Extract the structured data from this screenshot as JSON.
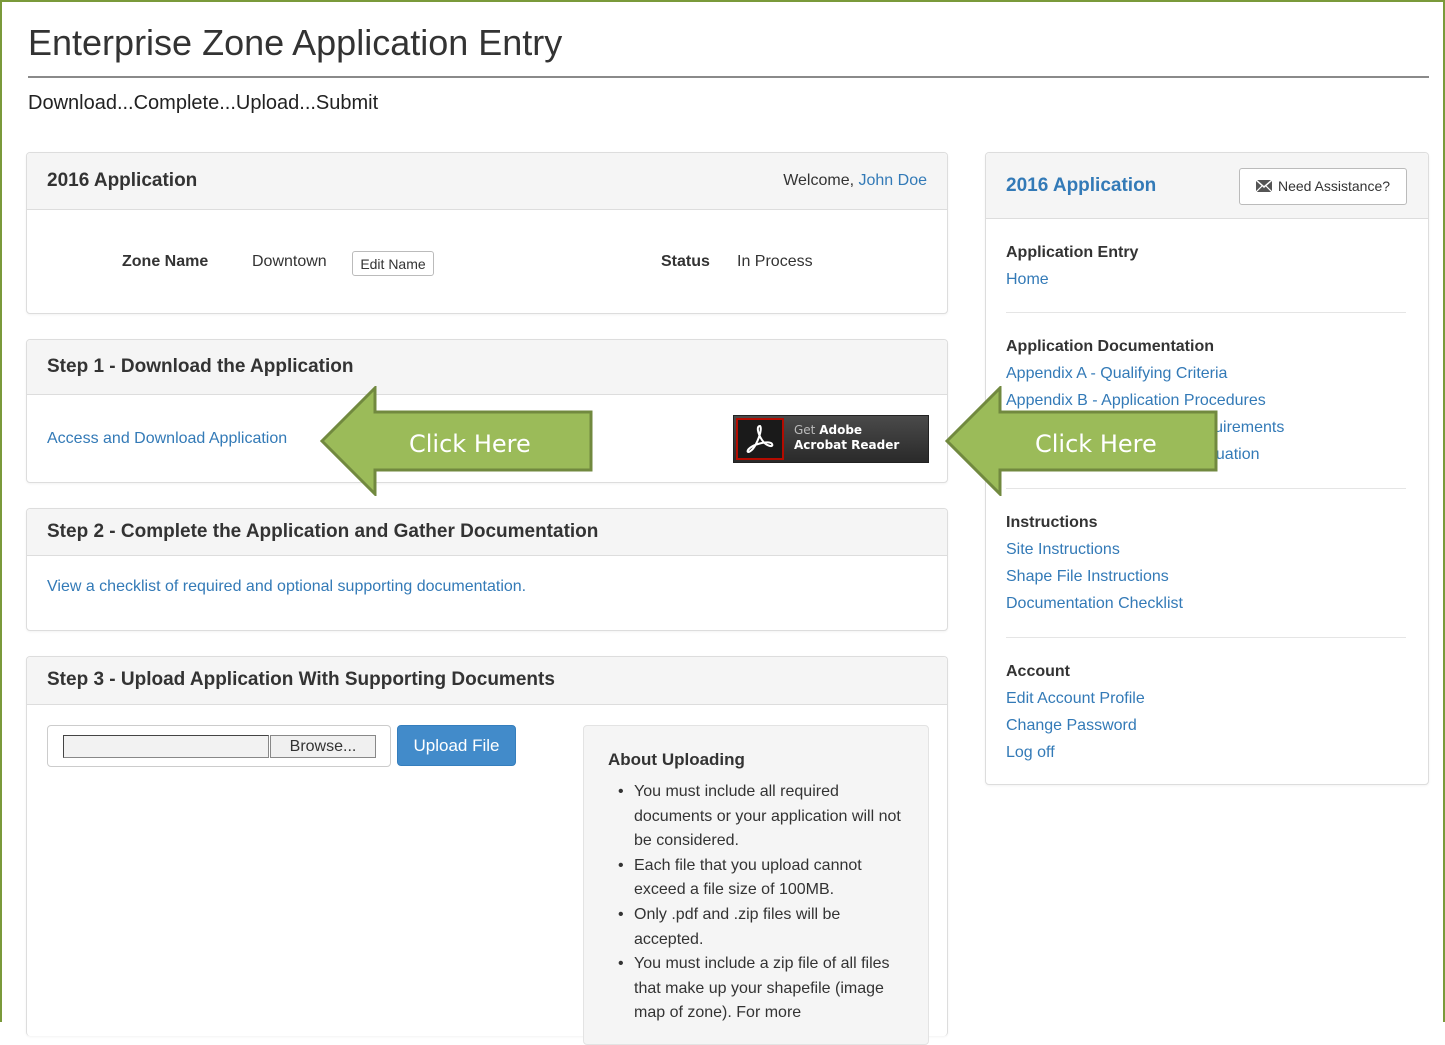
{
  "page": {
    "title": "Enterprise Zone Application Entry",
    "tagline": "Download...Complete...Upload...Submit"
  },
  "app_panel": {
    "heading": "2016 Application",
    "welcome_prefix": "Welcome,",
    "user_name": "John Doe",
    "zone_label": "Zone Name",
    "zone_value": "Downtown",
    "edit_name_button": "Edit Name",
    "status_label": "Status",
    "status_value": "In Process"
  },
  "step1": {
    "heading": "Step 1 - Download the Application",
    "link": "Access and Download Application",
    "adobe_get": "Get",
    "adobe_brand": "Adobe",
    "adobe_product": "Acrobat Reader"
  },
  "step2": {
    "heading": "Step 2 - Complete the Application and Gather Documentation",
    "link": "View a checklist of required and optional supporting documentation."
  },
  "step3": {
    "heading": "Step 3 - Upload Application With Supporting Documents",
    "file_input_value": "",
    "browse_button": "Browse...",
    "upload_button": "Upload File",
    "about_title": "About Uploading",
    "about_items": [
      "You must include all required documents or your application will not be considered.",
      "Each file that you upload cannot exceed a file size of 100MB.",
      "Only .pdf and .zip files will be accepted.",
      "You must include a zip file of all files that make up your shapefile (image map of zone). For more"
    ]
  },
  "sidebar": {
    "heading": "2016 Application",
    "assist_button": "Need Assistance?",
    "sections": [
      {
        "title": "Application Entry",
        "links": [
          "Home"
        ]
      },
      {
        "title": "Application Documentation",
        "links": [
          "Appendix A - Qualifying Criteria",
          "Appendix B - Application Procedures",
          "Appendix C - Application Requirements",
          "Appendix D - Application Evaluation"
        ]
      },
      {
        "title": "Instructions",
        "links": [
          "Site Instructions",
          "Shape File Instructions",
          "Documentation Checklist"
        ]
      },
      {
        "title": "Account",
        "links": [
          "Edit Account Profile",
          "Change Password",
          "Log off"
        ]
      }
    ]
  },
  "callouts": {
    "left": "Click Here",
    "right": "Click Here"
  },
  "colors": {
    "frame_border": "#7a9a3a",
    "link": "#337ab7",
    "arrow_fill": "#9bbb59",
    "arrow_stroke": "#71893f",
    "primary_button": "#428bca",
    "adobe_red": "#b30b00"
  },
  "icons": {
    "assist": "envelope-icon",
    "adobe": "acrobat-logo-icon",
    "callout": "left-arrow-icon"
  }
}
